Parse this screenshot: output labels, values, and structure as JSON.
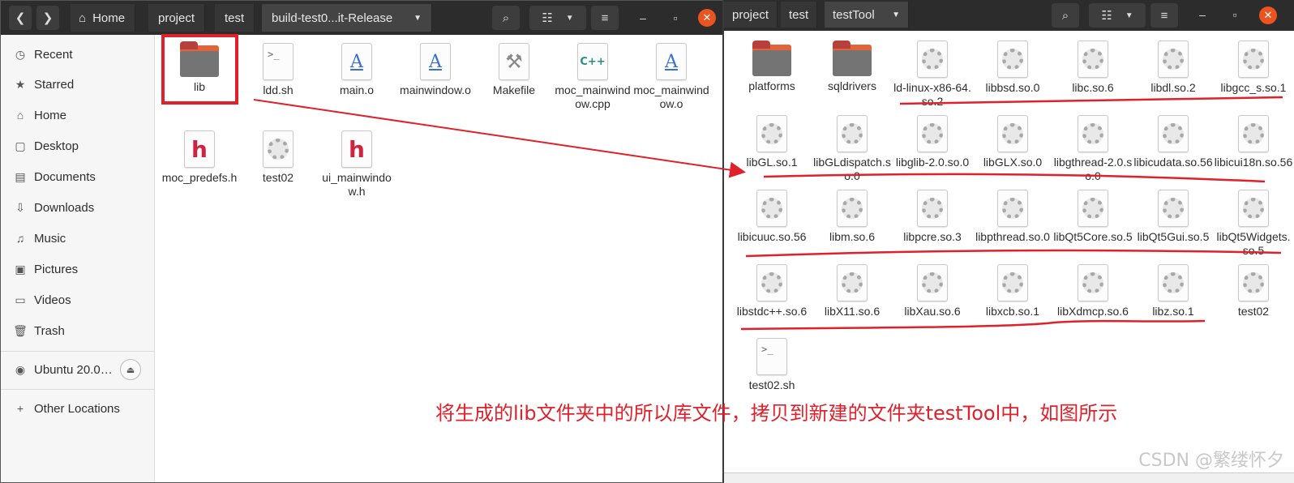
{
  "left_window": {
    "breadcrumbs": [
      "Home",
      "project",
      "test",
      "build-test0...it-Release"
    ],
    "sidebar": {
      "items": [
        {
          "label": "Recent",
          "icon": "clock-icon"
        },
        {
          "label": "Starred",
          "icon": "star-icon"
        },
        {
          "label": "Home",
          "icon": "home-icon"
        },
        {
          "label": "Desktop",
          "icon": "desktop-icon"
        },
        {
          "label": "Documents",
          "icon": "documents-icon"
        },
        {
          "label": "Downloads",
          "icon": "download-icon"
        },
        {
          "label": "Music",
          "icon": "music-icon"
        },
        {
          "label": "Pictures",
          "icon": "pictures-icon"
        },
        {
          "label": "Videos",
          "icon": "videos-icon"
        },
        {
          "label": "Trash",
          "icon": "trash-icon"
        }
      ],
      "device": {
        "label": "Ubuntu 20.0…",
        "icon": "disc-icon"
      },
      "other_locations": {
        "label": "Other Locations",
        "icon": "plus-icon"
      }
    },
    "files": [
      {
        "name": "lib",
        "type": "folder"
      },
      {
        "name": "ldd.sh",
        "type": "script"
      },
      {
        "name": "main.o",
        "type": "object"
      },
      {
        "name": "mainwindow.o",
        "type": "object"
      },
      {
        "name": "Makefile",
        "type": "makefile"
      },
      {
        "name": "moc_mainwindow.cpp",
        "type": "cpp"
      },
      {
        "name": "moc_mainwindow.o",
        "type": "object"
      },
      {
        "name": "moc_predefs.h",
        "type": "header"
      },
      {
        "name": "test02",
        "type": "binary"
      },
      {
        "name": "ui_mainwindow.h",
        "type": "header"
      }
    ]
  },
  "right_window": {
    "breadcrumbs": [
      "project",
      "test",
      "testTool"
    ],
    "files": [
      {
        "name": "platforms",
        "type": "folder"
      },
      {
        "name": "sqldrivers",
        "type": "folder"
      },
      {
        "name": "ld-linux-x86-64.so.2",
        "type": "binary"
      },
      {
        "name": "libbsd.so.0",
        "type": "binary"
      },
      {
        "name": "libc.so.6",
        "type": "binary"
      },
      {
        "name": "libdl.so.2",
        "type": "binary"
      },
      {
        "name": "libgcc_s.so.1",
        "type": "binary"
      },
      {
        "name": "libGL.so.1",
        "type": "binary"
      },
      {
        "name": "libGLdispatch.so.0",
        "type": "binary"
      },
      {
        "name": "libglib-2.0.so.0",
        "type": "binary"
      },
      {
        "name": "libGLX.so.0",
        "type": "binary"
      },
      {
        "name": "libgthread-2.0.so.0",
        "type": "binary"
      },
      {
        "name": "libicudata.so.56",
        "type": "binary"
      },
      {
        "name": "libicui18n.so.56",
        "type": "binary"
      },
      {
        "name": "libicuuc.so.56",
        "type": "binary"
      },
      {
        "name": "libm.so.6",
        "type": "binary"
      },
      {
        "name": "libpcre.so.3",
        "type": "binary"
      },
      {
        "name": "libpthread.so.0",
        "type": "binary"
      },
      {
        "name": "libQt5Core.so.5",
        "type": "binary"
      },
      {
        "name": "libQt5Gui.so.5",
        "type": "binary"
      },
      {
        "name": "libQt5Widgets.so.5",
        "type": "binary"
      },
      {
        "name": "libstdc++.so.6",
        "type": "binary"
      },
      {
        "name": "libX11.so.6",
        "type": "binary"
      },
      {
        "name": "libXau.so.6",
        "type": "binary"
      },
      {
        "name": "libxcb.so.1",
        "type": "binary"
      },
      {
        "name": "libXdmcp.so.6",
        "type": "binary"
      },
      {
        "name": "libz.so.1",
        "type": "binary"
      },
      {
        "name": "test02",
        "type": "binary"
      },
      {
        "name": "test02.sh",
        "type": "script"
      }
    ]
  },
  "annotation": {
    "caption": "将生成的lib文件夹中的所以库文件，拷贝到新建的文件夹testTool中，如图所示",
    "watermark": "CSDN @繁缕怀夕",
    "color": "#e0202a"
  }
}
